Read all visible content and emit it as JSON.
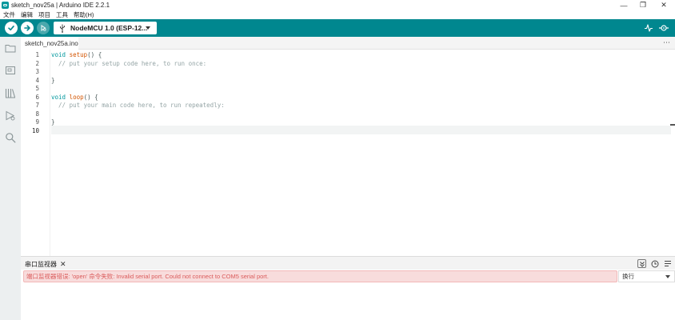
{
  "window": {
    "title": "sketch_nov25a | Arduino IDE 2.2.1",
    "minimize": "—",
    "maximize": "❐",
    "close": "✕"
  },
  "menu": [
    "文件",
    "编辑",
    "项目",
    "工具",
    "帮助(H)"
  ],
  "toolbar": {
    "board": "NodeMCU 1.0 (ESP-12..."
  },
  "tabs": [
    {
      "label": "sketch_nov25a.ino"
    }
  ],
  "tab_more": "⋯",
  "editor": {
    "line_numbers": [
      "1",
      "2",
      "3",
      "4",
      "5",
      "6",
      "7",
      "8",
      "9",
      "10"
    ],
    "lines": {
      "l1_kw": "void",
      "l1_fn": "setup",
      "l1_rest": "() {",
      "l2": "  // put your setup code here, to run once:",
      "l4": "}",
      "l6_kw": "void",
      "l6_fn": "loop",
      "l6_rest": "() {",
      "l7": "  // put your main code here, to run repeatedly:",
      "l9": "}"
    }
  },
  "serial_monitor": {
    "tab_label": "串口监视器",
    "close": "✕",
    "error": "端口监视器错误: 'open' 命令失败: Invalid serial port. Could not connect to COM5 serial port.",
    "line_ending": "换行"
  },
  "colors": {
    "accent": "#00878f",
    "keyword": "#00979d",
    "function": "#d35400",
    "comment": "#95a5a6",
    "error_bg": "#f8dcdc",
    "error_text": "#da5b5b"
  }
}
